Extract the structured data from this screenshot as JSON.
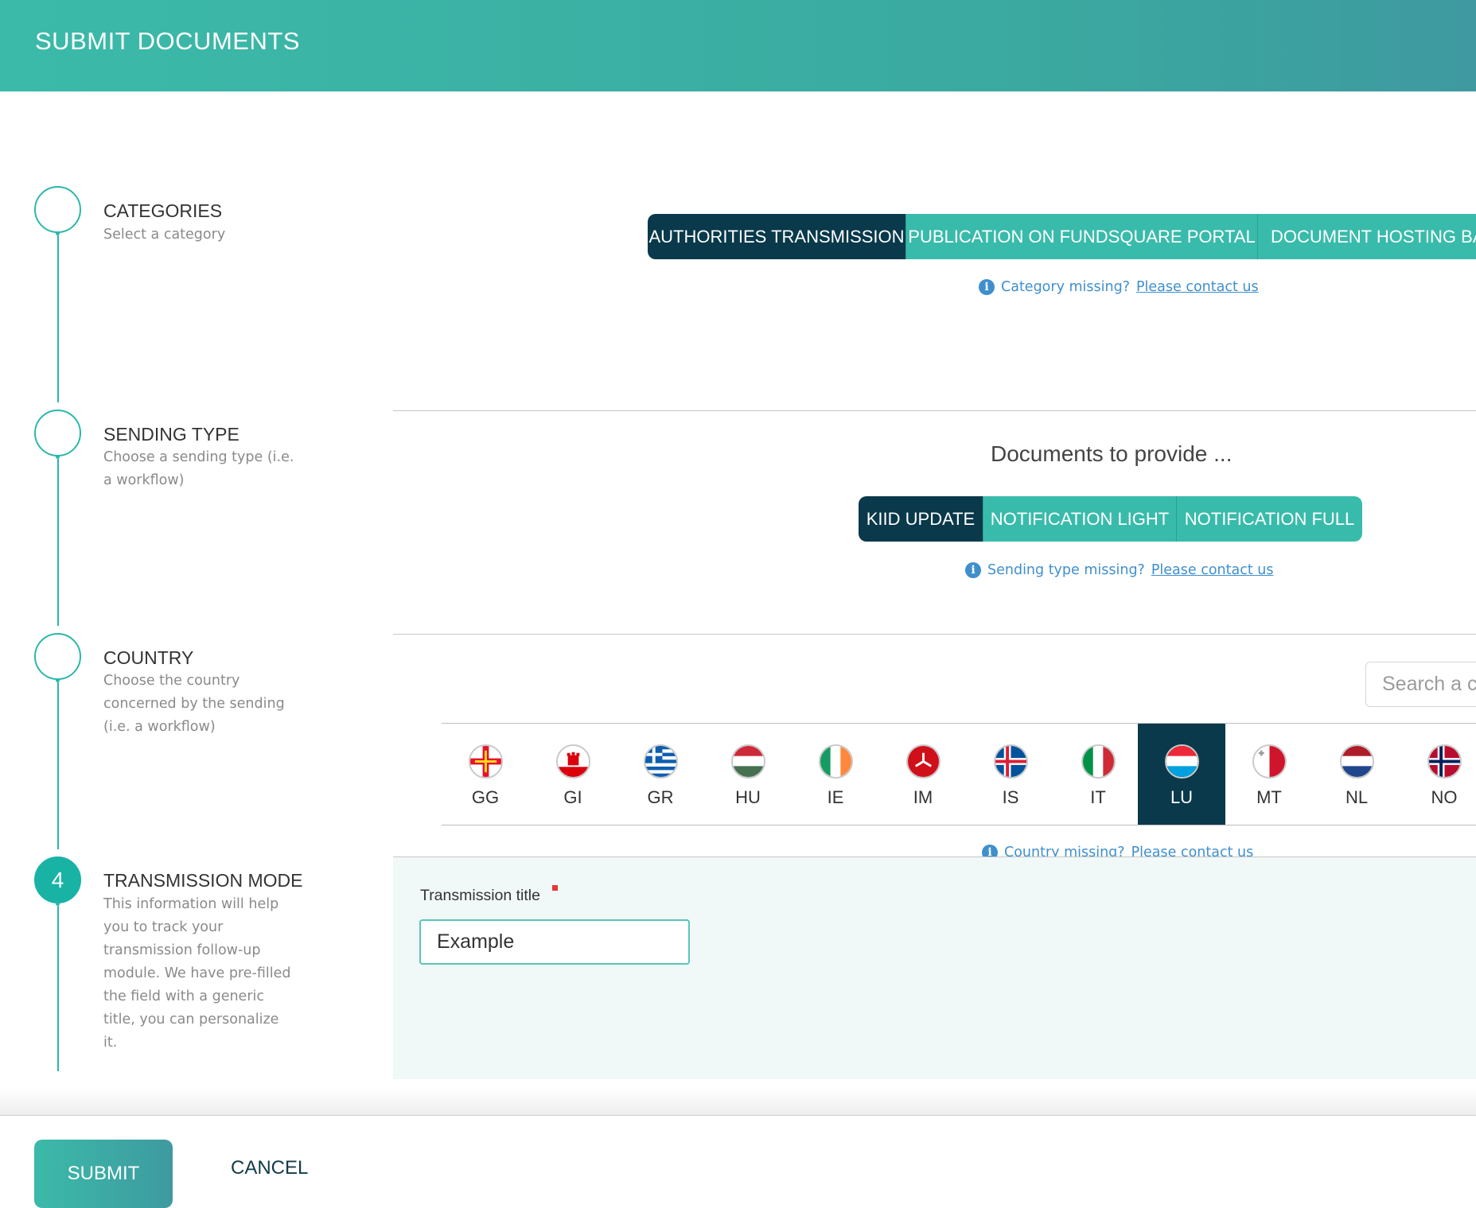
{
  "header": {
    "title": "SUBMIT DOCUMENTS"
  },
  "steps": [
    {
      "number": "",
      "title": "CATEGORIES",
      "desc": "Select a category"
    },
    {
      "number": "",
      "title": "SENDING TYPE",
      "desc": "Choose a sending type (i.e. a workflow)"
    },
    {
      "number": "",
      "title": "COUNTRY",
      "desc": "Choose the country concerned by the sending (i.e. a workflow)"
    },
    {
      "number": "4",
      "title": "TRANSMISSION MODE",
      "desc": "This information will help you to track your transmission follow-up module. We have pre-filled the field with a generic title, you can personalize it."
    }
  ],
  "categories": {
    "buttons": [
      "AUTHORITIES TRANSMISSION",
      "PUBLICATION ON FUNDSQUARE PORTAL",
      "DOCUMENT HOSTING BAS"
    ],
    "selected": "AUTHORITIES TRANSMISSION",
    "info_text": "Category missing?",
    "info_link": "Please contact us"
  },
  "sending_type": {
    "title": "Documents to provide ...",
    "buttons": [
      "KIID UPDATE",
      "NOTIFICATION LIGHT",
      "NOTIFICATION FULL"
    ],
    "selected": "KIID UPDATE",
    "info_text": "Sending type missing?",
    "info_link": "Please contact us"
  },
  "country": {
    "search_placeholder": "Search a c",
    "flags": [
      "GG",
      "GI",
      "GR",
      "HU",
      "IE",
      "IM",
      "IS",
      "IT",
      "LU",
      "MT",
      "NL",
      "NO"
    ],
    "selected": "LU",
    "info_text": "Country missing?",
    "info_link": "Please contact us"
  },
  "transmission": {
    "label": "Transmission title",
    "value": "Example"
  },
  "footer": {
    "submit": "SUBMIT",
    "cancel": "CANCEL"
  },
  "colors": {
    "teal": "#39bbab",
    "navy": "#09394a",
    "link": "#3f8fcd",
    "required": "#e53935"
  }
}
